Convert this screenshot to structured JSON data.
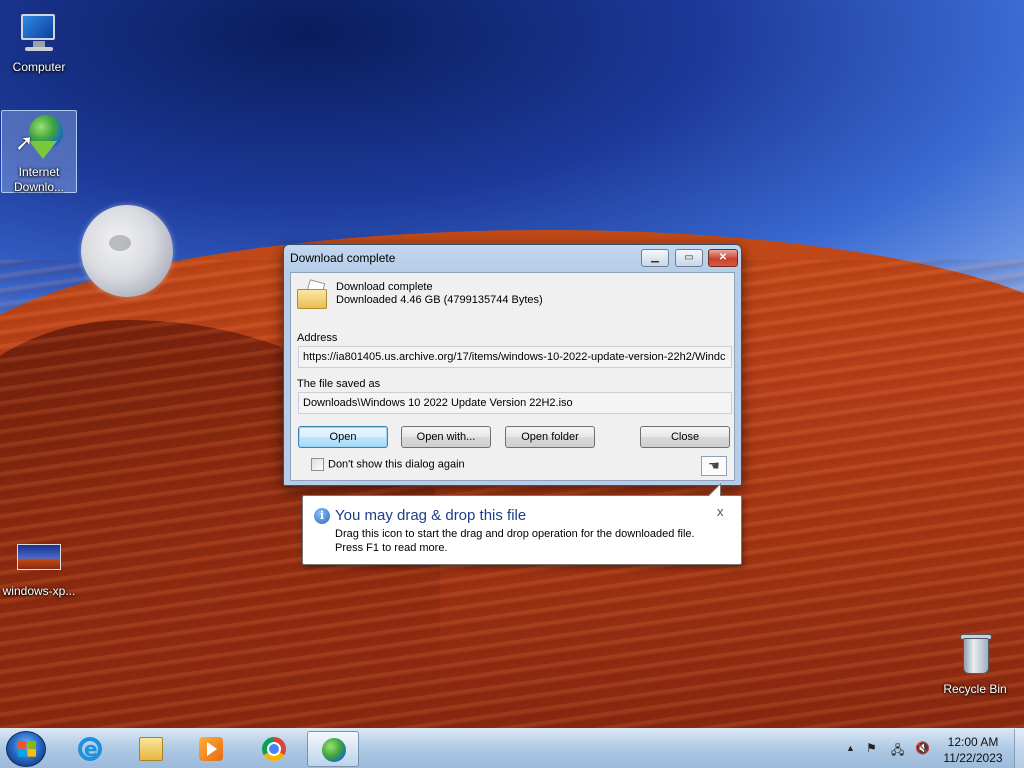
{
  "desktop": {
    "icons": [
      {
        "label": "Computer"
      },
      {
        "label": "Internet\nDownlo..."
      },
      {
        "label": "windows-xp..."
      },
      {
        "label": "Recycle Bin"
      }
    ]
  },
  "dialog": {
    "title": "Download complete",
    "status_line1": "Download complete",
    "status_line2": "Downloaded 4.46  GB (4799135744 Bytes)",
    "address_label": "Address",
    "address_value": "https://ia801405.us.archive.org/17/items/windows-10-2022-update-version-22h2/Windc",
    "saved_label": "The file saved as",
    "saved_value": "Downloads\\Windows 10  2022 Update Version 22H2.iso",
    "buttons": {
      "open": "Open",
      "open_with": "Open with...",
      "open_folder": "Open folder",
      "close": "Close"
    },
    "checkbox_label": "Don't show this dialog again",
    "checkbox_checked": false
  },
  "balloon": {
    "title": "You may drag & drop this file",
    "line1": "Drag this icon to start the drag and drop operation for the downloaded file.",
    "line2": "Press F1 to read more.",
    "close_glyph": "x"
  },
  "taskbar": {
    "apps": [
      "internet-explorer",
      "windows-explorer",
      "windows-media-player",
      "google-chrome",
      "internet-download-manager"
    ],
    "active_app": "internet-download-manager",
    "tray": {
      "show_hidden": "▲",
      "clock_time": "12:00 AM",
      "clock_date": "11/22/2023"
    }
  }
}
